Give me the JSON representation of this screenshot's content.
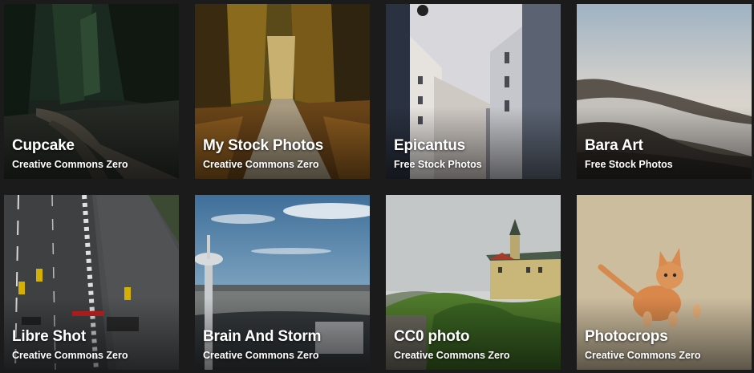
{
  "cards": [
    {
      "title": "Cupcake",
      "subtitle": "Creative Commons Zero"
    },
    {
      "title": "My Stock Photos",
      "subtitle": "Creative Commons Zero"
    },
    {
      "title": "Epicantus",
      "subtitle": "Free Stock Photos"
    },
    {
      "title": "Bara Art",
      "subtitle": "Free Stock Photos"
    },
    {
      "title": "Libre Shot",
      "subtitle": "Creative Commons Zero"
    },
    {
      "title": "Brain And Storm",
      "subtitle": "Creative Commons Zero"
    },
    {
      "title": "CC0 photo",
      "subtitle": "Creative Commons Zero"
    },
    {
      "title": "Photocrops",
      "subtitle": "Creative Commons Zero"
    }
  ]
}
